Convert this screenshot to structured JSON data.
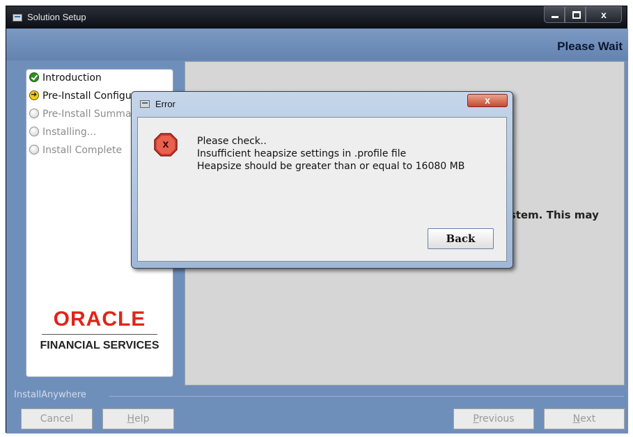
{
  "window": {
    "title": "Solution Setup",
    "controls": {
      "minimize": "",
      "maximize": "",
      "close": "x"
    }
  },
  "header": {
    "title": "Please Wait"
  },
  "steps": [
    {
      "label": "Introduction",
      "state": "complete",
      "icon": "check-icon"
    },
    {
      "label": "Pre-Install Configuration",
      "state": "current",
      "icon": "arrow-icon"
    },
    {
      "label": "Pre-Install Summary",
      "state": "pending",
      "icon": "radio-icon"
    },
    {
      "label": "Installing...",
      "state": "pending",
      "icon": "radio-icon"
    },
    {
      "label": "Install Complete",
      "state": "pending",
      "icon": "radio-icon"
    }
  ],
  "branding": {
    "logo_text": "ORACLE",
    "subtitle": "FINANCIAL SERVICES"
  },
  "content": {
    "visible_text": "ystem.  This may"
  },
  "footer": {
    "brand_label": "InstallAnywhere",
    "buttons": {
      "cancel": "Cancel",
      "help_mnemonic": "H",
      "help_rest": "elp",
      "previous_mnemonic": "P",
      "previous_rest": "revious",
      "next_mnemonic": "N",
      "next_rest": "ext"
    }
  },
  "error_dialog": {
    "title": "Error",
    "close_label": "x",
    "icon_glyph": "x",
    "lines": [
      "Please check..",
      "Insufficient heapsize settings in .profile file",
      "Heapsize should be greater than or equal to 16080 MB"
    ],
    "back_label": "Back"
  },
  "colors": {
    "accent": "#6f8fbb",
    "oracle_red": "#e2231a",
    "error_red": "#d13a2c"
  }
}
